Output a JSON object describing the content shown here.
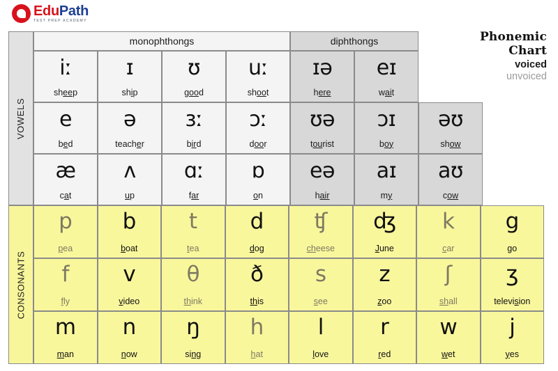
{
  "logo": {
    "edu": "Edu",
    "path": "Path",
    "tagline": "TEST PREP ACADEMY"
  },
  "title": {
    "line1": "Phonemic",
    "line2": "Chart",
    "legend_voiced": "voiced",
    "legend_unvoiced": "unvoiced"
  },
  "side_labels": {
    "vowels": "VOWELS",
    "consonants": "CONSONANTS"
  },
  "group_headers": {
    "monophthongs": "monophthongs",
    "diphthongs": "diphthongs"
  },
  "vowels": {
    "rows": [
      [
        {
          "symbol": "iː",
          "word": "sheep",
          "pre": "sh",
          "mid": "ee",
          "post": "p",
          "type": "monophthong"
        },
        {
          "symbol": "ɪ",
          "word": "ship",
          "pre": "sh",
          "mid": "i",
          "post": "p",
          "type": "monophthong"
        },
        {
          "symbol": "ʊ",
          "word": "good",
          "pre": "g",
          "mid": "oo",
          "post": "d",
          "type": "monophthong"
        },
        {
          "symbol": "uː",
          "word": "shoot",
          "pre": "sh",
          "mid": "oo",
          "post": "t",
          "type": "monophthong"
        },
        {
          "symbol": "ɪə",
          "word": "here",
          "pre": "h",
          "mid": "ere",
          "post": "",
          "type": "diphthong"
        },
        {
          "symbol": "eɪ",
          "word": "wait",
          "pre": "w",
          "mid": "ai",
          "post": "t",
          "type": "diphthong"
        }
      ],
      [
        {
          "symbol": "e",
          "word": "bed",
          "pre": "b",
          "mid": "e",
          "post": "d",
          "type": "monophthong"
        },
        {
          "symbol": "ə",
          "word": "teacher",
          "pre": "teach",
          "mid": "e",
          "post": "r",
          "type": "monophthong"
        },
        {
          "symbol": "ɜː",
          "word": "bird",
          "pre": "b",
          "mid": "ir",
          "post": "d",
          "type": "monophthong"
        },
        {
          "symbol": "ɔː",
          "word": "door",
          "pre": "d",
          "mid": "oo",
          "post": "r",
          "type": "monophthong"
        },
        {
          "symbol": "ʊə",
          "word": "tourist",
          "pre": "t",
          "mid": "ou",
          "post": "rist",
          "type": "diphthong"
        },
        {
          "symbol": "ɔɪ",
          "word": "boy",
          "pre": "b",
          "mid": "oy",
          "post": "",
          "type": "diphthong"
        },
        {
          "symbol": "əʊ",
          "word": "show",
          "pre": "sh",
          "mid": "ow",
          "post": "",
          "type": "diphthong"
        }
      ],
      [
        {
          "symbol": "æ",
          "word": "cat",
          "pre": "c",
          "mid": "a",
          "post": "t",
          "type": "monophthong"
        },
        {
          "symbol": "ʌ",
          "word": "up",
          "pre": "",
          "mid": "u",
          "post": "p",
          "type": "monophthong"
        },
        {
          "symbol": "ɑː",
          "word": "far",
          "pre": "f",
          "mid": "ar",
          "post": "",
          "type": "monophthong"
        },
        {
          "symbol": "ɒ",
          "word": "on",
          "pre": "",
          "mid": "o",
          "post": "n",
          "type": "monophthong"
        },
        {
          "symbol": "eə",
          "word": "hair",
          "pre": "h",
          "mid": "air",
          "post": "",
          "type": "diphthong"
        },
        {
          "symbol": "aɪ",
          "word": "my",
          "pre": "m",
          "mid": "y",
          "post": "",
          "type": "diphthong"
        },
        {
          "symbol": "aʊ",
          "word": "cow",
          "pre": "c",
          "mid": "ow",
          "post": "",
          "type": "diphthong"
        }
      ]
    ]
  },
  "consonants": {
    "rows": [
      [
        {
          "symbol": "p",
          "word": "pea",
          "pre": "",
          "mid": "p",
          "post": "ea",
          "voicing": "unvoiced"
        },
        {
          "symbol": "b",
          "word": "boat",
          "pre": "",
          "mid": "b",
          "post": "oat",
          "voicing": "voiced"
        },
        {
          "symbol": "t",
          "word": "tea",
          "pre": "",
          "mid": "t",
          "post": "ea",
          "voicing": "unvoiced"
        },
        {
          "symbol": "d",
          "word": "dog",
          "pre": "",
          "mid": "d",
          "post": "og",
          "voicing": "voiced"
        },
        {
          "symbol": "ʧ",
          "word": "cheese",
          "pre": "",
          "mid": "ch",
          "post": "eese",
          "voicing": "unvoiced"
        },
        {
          "symbol": "ʤ",
          "word": "June",
          "pre": "",
          "mid": "J",
          "post": "une",
          "voicing": "voiced"
        },
        {
          "symbol": "k",
          "word": "car",
          "pre": "",
          "mid": "c",
          "post": "ar",
          "voicing": "unvoiced"
        },
        {
          "symbol": "g",
          "word": "go",
          "pre": "",
          "mid": "g",
          "post": "o",
          "voicing": "voiced"
        }
      ],
      [
        {
          "symbol": "f",
          "word": "fly",
          "pre": "",
          "mid": "f",
          "post": "ly",
          "voicing": "unvoiced"
        },
        {
          "symbol": "v",
          "word": "video",
          "pre": "",
          "mid": "v",
          "post": "ideo",
          "voicing": "voiced"
        },
        {
          "symbol": "θ",
          "word": "think",
          "pre": "",
          "mid": "th",
          "post": "ink",
          "voicing": "unvoiced"
        },
        {
          "symbol": "ð",
          "word": "this",
          "pre": "",
          "mid": "th",
          "post": "is",
          "voicing": "voiced"
        },
        {
          "symbol": "s",
          "word": "see",
          "pre": "",
          "mid": "s",
          "post": "ee",
          "voicing": "unvoiced"
        },
        {
          "symbol": "z",
          "word": "zoo",
          "pre": "",
          "mid": "z",
          "post": "oo",
          "voicing": "voiced"
        },
        {
          "symbol": "ʃ",
          "word": "shall",
          "pre": "",
          "mid": "sh",
          "post": "all",
          "voicing": "unvoiced"
        },
        {
          "symbol": "ʒ",
          "word": "television",
          "pre": "televi",
          "mid": "s",
          "post": "ion",
          "voicing": "voiced"
        }
      ],
      [
        {
          "symbol": "m",
          "word": "man",
          "pre": "",
          "mid": "m",
          "post": "an",
          "voicing": "voiced"
        },
        {
          "symbol": "n",
          "word": "now",
          "pre": "",
          "mid": "n",
          "post": "ow",
          "voicing": "voiced"
        },
        {
          "symbol": "ŋ",
          "word": "sing",
          "pre": "si",
          "mid": "ng",
          "post": "",
          "voicing": "voiced"
        },
        {
          "symbol": "h",
          "word": "hat",
          "pre": "",
          "mid": "h",
          "post": "at",
          "voicing": "unvoiced"
        },
        {
          "symbol": "l",
          "word": "love",
          "pre": "",
          "mid": "l",
          "post": "ove",
          "voicing": "voiced"
        },
        {
          "symbol": "r",
          "word": "red",
          "pre": "",
          "mid": "r",
          "post": "ed",
          "voicing": "voiced"
        },
        {
          "symbol": "w",
          "word": "wet",
          "pre": "",
          "mid": "w",
          "post": "et",
          "voicing": "voiced"
        },
        {
          "symbol": "j",
          "word": "yes",
          "pre": "",
          "mid": "y",
          "post": "es",
          "voicing": "voiced"
        }
      ]
    ]
  },
  "colors": {
    "vowel_mono_bg": "#f4f4f4",
    "vowel_diph_bg": "#d8d8d8",
    "consonant_bg": "#f9f79c",
    "rail_vowel_bg": "#e2e2e2",
    "border": "#8a8a8a",
    "voiced_text": "#111111",
    "unvoiced_text": "#7d7a62",
    "logo_red": "#d8121c",
    "logo_blue": "#1c3f94"
  }
}
